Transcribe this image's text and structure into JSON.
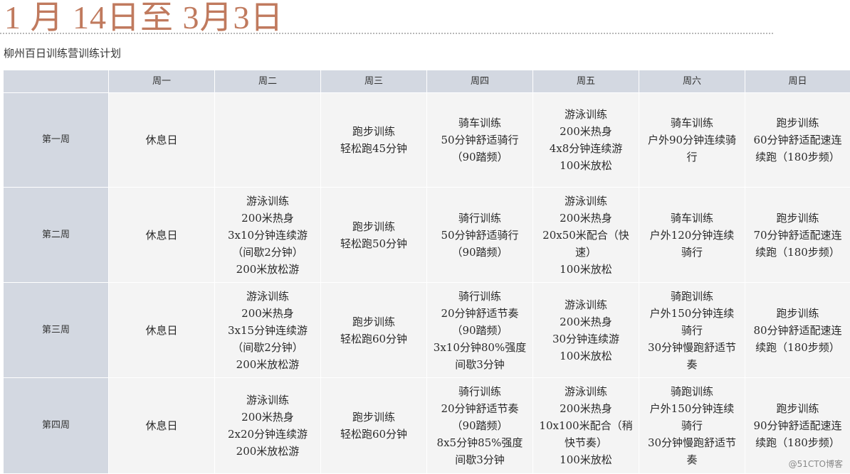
{
  "title": "1 月 14日至 3月3日",
  "subtitle": "柳州百日训练营训练计划",
  "table": {
    "corner": "",
    "headers": [
      "周一",
      "周二",
      "周三",
      "周四",
      "周五",
      "周六",
      "周日"
    ],
    "rows": [
      {
        "label": "第一周",
        "cells": [
          [
            "休息日"
          ],
          [],
          [
            "跑步训练",
            "轻松跑45分钟"
          ],
          [
            "骑车训练",
            "50分钟舒适骑行",
            "（90踏频）"
          ],
          [
            "游泳训练",
            "200米热身",
            "4x8分钟连续游",
            "100米放松"
          ],
          [
            "骑车训练",
            "户外90分钟连续骑",
            "行"
          ],
          [
            "跑步训练",
            "60分钟舒适配速连",
            "续跑（180步频）"
          ]
        ]
      },
      {
        "label": "第二周",
        "cells": [
          [
            "休息日"
          ],
          [
            "游泳训练",
            "200米热身",
            "3x10分钟连续游",
            "（间歇2分钟）",
            "200米放松游"
          ],
          [
            "跑步训练",
            "轻松跑50分钟"
          ],
          [
            "骑行训练",
            "50分钟舒适骑行",
            "（90踏频）"
          ],
          [
            "游泳训练",
            "200米热身",
            "20x50米配合（快",
            "速）",
            "100米放松"
          ],
          [
            "骑车训练",
            "户外120分钟连续",
            "骑行"
          ],
          [
            "跑步训练",
            "70分钟舒适配速连",
            "续跑（180步频）"
          ]
        ]
      },
      {
        "label": "第三周",
        "cells": [
          [
            "休息日"
          ],
          [
            "游泳训练",
            "200米热身",
            "3x15分钟连续游",
            "（间歇2分钟）",
            "200米放松游"
          ],
          [
            "跑步训练",
            "轻松跑60分钟"
          ],
          [
            "骑行训练",
            "20分钟舒适节奏",
            "（90踏频）",
            "3x10分钟80%强度",
            "间歇3分钟"
          ],
          [
            "游泳训练",
            "200米热身",
            "30分钟连续游",
            "100米放松"
          ],
          [
            "骑跑训练",
            "户外150分钟连续",
            "骑行",
            "30分钟慢跑舒适节",
            "奏"
          ],
          [
            "跑步训练",
            "80分钟舒适配速连",
            "续跑（180步频）"
          ]
        ]
      },
      {
        "label": "第四周",
        "cells": [
          [
            "休息日"
          ],
          [
            "游泳训练",
            "200米热身",
            "2x20分钟连续游",
            "200米放松游"
          ],
          [
            "跑步训练",
            "轻松跑60分钟"
          ],
          [
            "骑行训练",
            "20分钟舒适节奏",
            "（90踏频）",
            "8x5分钟85%强度",
            "间歇3分钟"
          ],
          [
            "游泳训练",
            "200米热身",
            "10x100米配合（稍",
            "快节奏）",
            "100米放松"
          ],
          [
            "骑跑训练",
            "户外150分钟连续",
            "骑行",
            "30分钟慢跑舒适节",
            "奏"
          ],
          [
            "跑步训练",
            "90分钟舒适配速连",
            "续跑（180步频）"
          ]
        ]
      }
    ]
  },
  "watermark": "@51CTO博客",
  "colors": {
    "title": "#c07a5e",
    "header_bg": "#d3d8e1",
    "cell_bg": "#f4f4f4"
  }
}
